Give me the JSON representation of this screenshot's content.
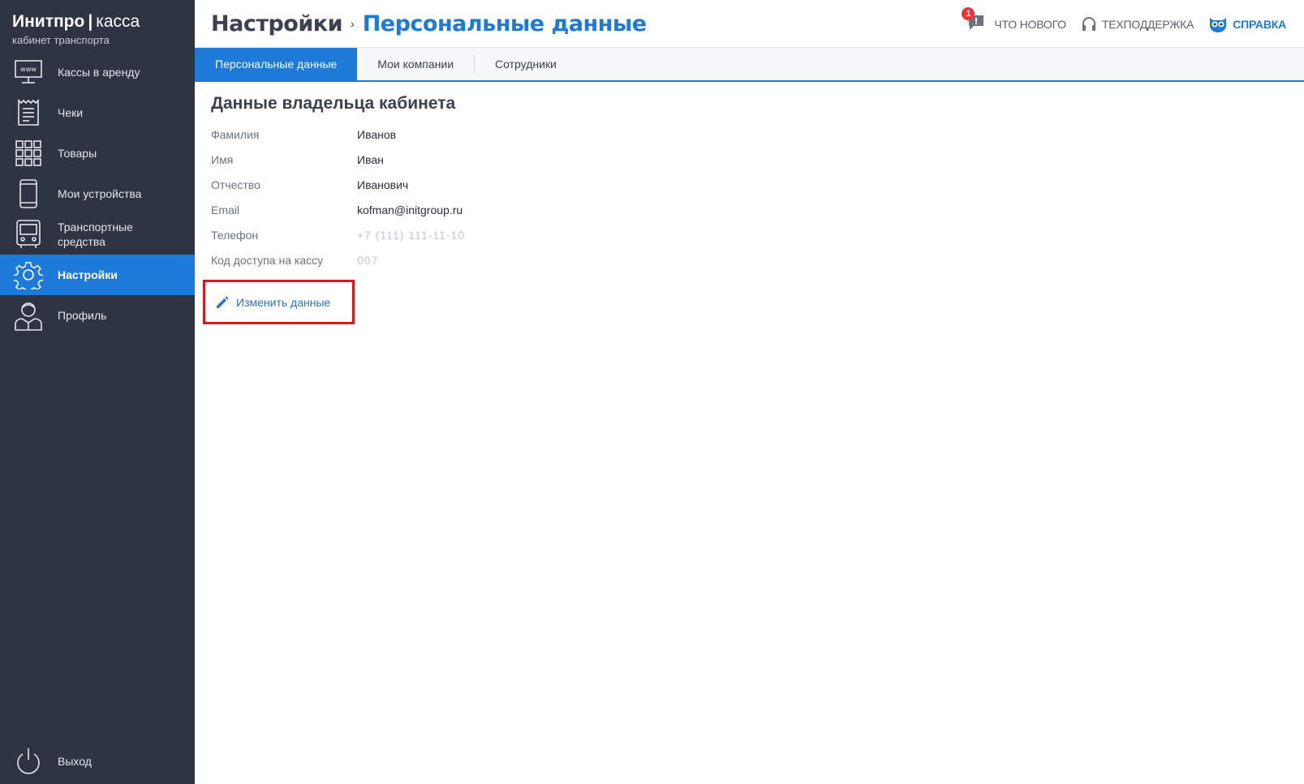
{
  "brand": {
    "name": "Инитпро",
    "separator": "|",
    "product": "касса",
    "subtitle": "кабинет транспорта"
  },
  "sidebar": {
    "items": [
      {
        "label": "Кассы в аренду",
        "icon": "www-monitor-icon"
      },
      {
        "label": "Чеки",
        "icon": "receipt-icon"
      },
      {
        "label": "Товары",
        "icon": "grid-icon"
      },
      {
        "label": "Мои устройства",
        "icon": "phone-icon"
      },
      {
        "label": "Транспортные средства",
        "icon": "bus-icon"
      },
      {
        "label": "Настройки",
        "icon": "gear-icon",
        "active": true
      },
      {
        "label": "Профиль",
        "icon": "user-icon"
      }
    ],
    "logout_label": "Выход"
  },
  "header": {
    "breadcrumb_root": "Настройки",
    "breadcrumb_sep": "›",
    "breadcrumb_current": "Персональные данные",
    "whats_new_label": "ЧТО НОВОГО",
    "whats_new_badge": "1",
    "support_label": "ТЕХПОДДЕРЖКА",
    "help_label": "СПРАВКА"
  },
  "tabs": [
    {
      "label": "Персональные данные",
      "active": true
    },
    {
      "label": "Мои компании"
    },
    {
      "label": "Сотрудники"
    }
  ],
  "owner": {
    "title": "Данные владельца кабинета",
    "fields": [
      {
        "label": "Фамилия",
        "value": "Иванов"
      },
      {
        "label": "Имя",
        "value": "Иван"
      },
      {
        "label": "Отчество",
        "value": "Иванович"
      },
      {
        "label": "Email",
        "value": "kofman@initgroup.ru"
      },
      {
        "label": "Телефон",
        "value": "+7 (111) 111-11-10"
      },
      {
        "label": "Код доступа на кассу",
        "value": "007"
      }
    ],
    "edit_label": "Изменить данные"
  },
  "colors": {
    "sidebar_bg": "#2f3442",
    "accent": "#1e7ad8",
    "highlight_border": "#e0121a"
  }
}
